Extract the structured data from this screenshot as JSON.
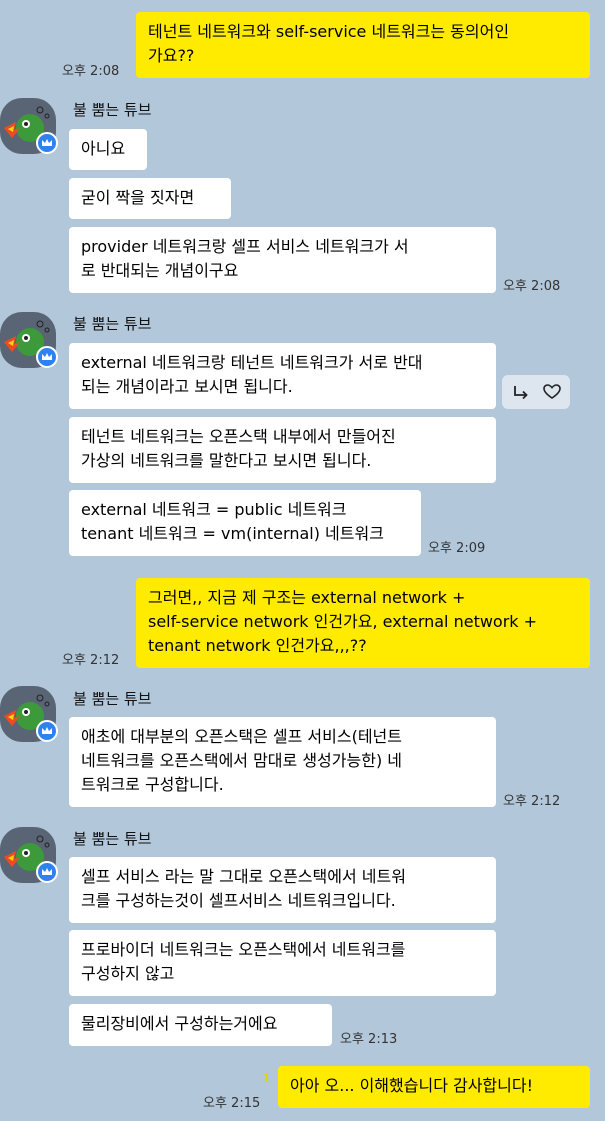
{
  "sender_name": "불 뿜는 튜브",
  "messages": [
    {
      "type": "out",
      "lines": [
        "테넌트 네트워크와 self-service 네트워크는 동의어인",
        "가요??"
      ],
      "time": "오후 2:08"
    },
    {
      "type": "in",
      "lines": [
        "아니요"
      ]
    },
    {
      "type": "in",
      "lines": [
        "굳이 짝을 짓자면"
      ]
    },
    {
      "type": "in",
      "lines": [
        "provider 네트워크랑 셀프 서비스 네트워크가 서",
        "로 반대되는 개념이구요"
      ],
      "time": "오후 2:08"
    },
    {
      "type": "in",
      "lines": [
        "external 네트워크랑 테넌트 네트워크가 서로 반대",
        "되는 개념이라고 보시면 됩니다."
      ]
    },
    {
      "type": "in",
      "lines": [
        "테넌트 네트워크는 오픈스택 내부에서 만들어진",
        "가상의 네트워크를 말한다고 보시면 됩니다."
      ]
    },
    {
      "type": "in",
      "lines": [
        "external 네트워크 = public 네트워크",
        "tenant 네트워크 = vm(internal) 네트워크"
      ],
      "time": "오후 2:09"
    },
    {
      "type": "out",
      "lines": [
        "그러면,, 지금 제 구조는 external network +",
        "self-service network 인건가요, external network +",
        "tenant network 인건가요,,,??"
      ],
      "time": "오후 2:12"
    },
    {
      "type": "in",
      "lines": [
        "애초에 대부분의 오픈스택은 셀프 서비스(테넌트",
        "네트워크를 오픈스택에서 맘대로 생성가능한) 네",
        "트워크로 구성합니다."
      ],
      "time": "오후 2:12"
    },
    {
      "type": "in",
      "lines": [
        "셀프 서비스 라는 말 그대로 오픈스택에서 네트워",
        "크를 구성하는것이 셀프서비스 네트워크입니다."
      ]
    },
    {
      "type": "in",
      "lines": [
        "프로바이더 네트워크는 오픈스택에서 네트워크를",
        "구성하지 않고"
      ]
    },
    {
      "type": "in",
      "lines": [
        "물리장비에서 구성하는거에요"
      ],
      "time": "오후 2:13"
    },
    {
      "type": "out",
      "lines": [
        "아아 오... 이해했습니다 감사합니다!"
      ],
      "time": "오후 2:15",
      "unread": "1"
    }
  ],
  "icons": {
    "reply": "reply-arrow-icon",
    "like": "heart-icon",
    "badge": "crown-badge-icon"
  },
  "colors": {
    "background": "#b2c7da",
    "outgoing_bubble": "#ffeb00",
    "incoming_bubble": "#ffffff",
    "badge": "#2e82f0"
  }
}
